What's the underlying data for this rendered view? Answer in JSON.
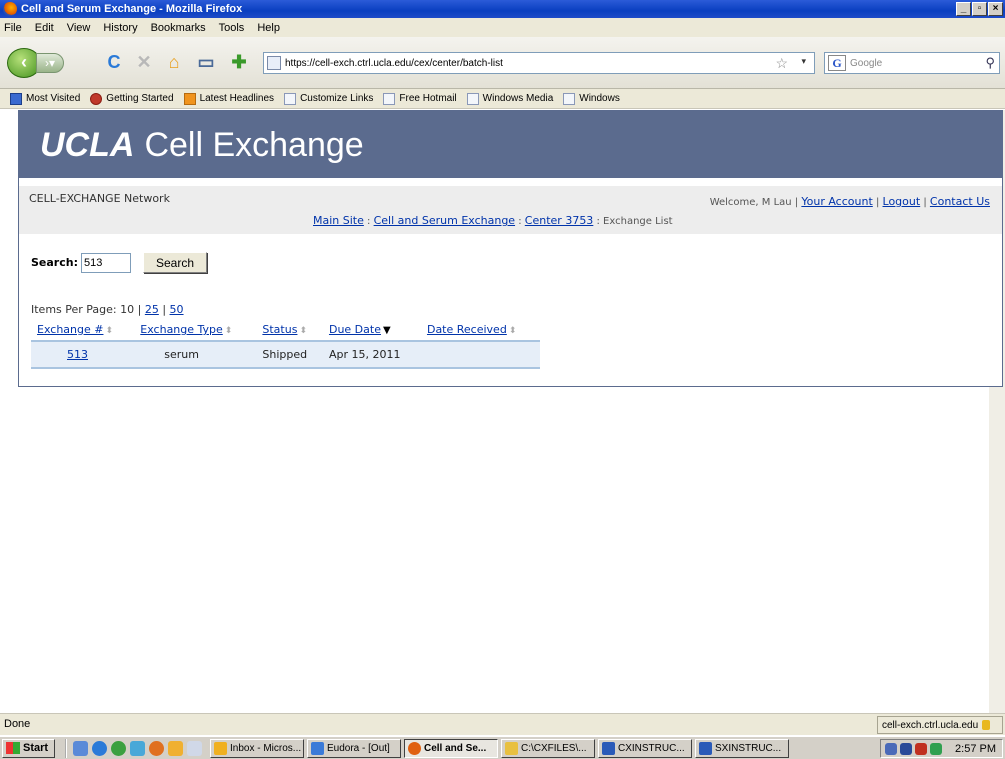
{
  "window": {
    "title": "Cell and Serum Exchange - Mozilla Firefox"
  },
  "menu": [
    "File",
    "Edit",
    "View",
    "History",
    "Bookmarks",
    "Tools",
    "Help"
  ],
  "nav": {
    "url": "https://cell-exch.ctrl.ucla.edu/cex/center/batch-list",
    "search_placeholder": "Google"
  },
  "bookmarks": [
    {
      "label": "Most Visited",
      "icon": "blue"
    },
    {
      "label": "Getting Started",
      "icon": "red"
    },
    {
      "label": "Latest Headlines",
      "icon": "rss"
    },
    {
      "label": "Customize Links",
      "icon": "page"
    },
    {
      "label": "Free Hotmail",
      "icon": "page"
    },
    {
      "label": "Windows Media",
      "icon": "page"
    },
    {
      "label": "Windows",
      "icon": "page"
    }
  ],
  "banner": {
    "brand": "UCLA",
    "title": "Cell Exchange"
  },
  "header": {
    "network": "CELL-EXCHANGE Network",
    "welcome": "Welcome, M Lau",
    "your_account": "Your Account",
    "logout": "Logout",
    "contact": "Contact Us",
    "sep": " | "
  },
  "breadcrumb": {
    "main_site": "Main Site",
    "cell_serum": "Cell and Serum Exchange",
    "center": "Center 3753",
    "current": "Exchange List",
    "sep": " : "
  },
  "search": {
    "label": "Search:",
    "value": "513",
    "button": "Search"
  },
  "paging": {
    "label": "Items Per Page:",
    "current": "10",
    "opt2": "25",
    "opt3": "50",
    "sep": " | "
  },
  "table": {
    "columns": [
      "Exchange #",
      "Exchange Type",
      "Status",
      "Due Date",
      "Date Received"
    ],
    "rows": [
      {
        "exchange": "513",
        "type": "serum",
        "status": "Shipped",
        "due": "Apr 15, 2011",
        "received": ""
      }
    ]
  },
  "statusbar": {
    "text": "Done",
    "host": "cell-exch.ctrl.ucla.edu"
  },
  "taskbar": {
    "start": "Start",
    "tasks": [
      {
        "label": "Inbox - Micros...",
        "color": "#f0b020",
        "active": false
      },
      {
        "label": "Eudora - [Out]",
        "color": "#3a7ad8",
        "active": false
      },
      {
        "label": "Cell and Se...",
        "color": "#e06010",
        "active": true
      },
      {
        "label": "C:\\CXFILES\\...",
        "color": "#e8c040",
        "active": false
      },
      {
        "label": "CXINSTRUC...",
        "color": "#2a5ab8",
        "active": false
      },
      {
        "label": "SXINSTRUC...",
        "color": "#2a5ab8",
        "active": false
      }
    ],
    "clock": "2:57 PM"
  }
}
